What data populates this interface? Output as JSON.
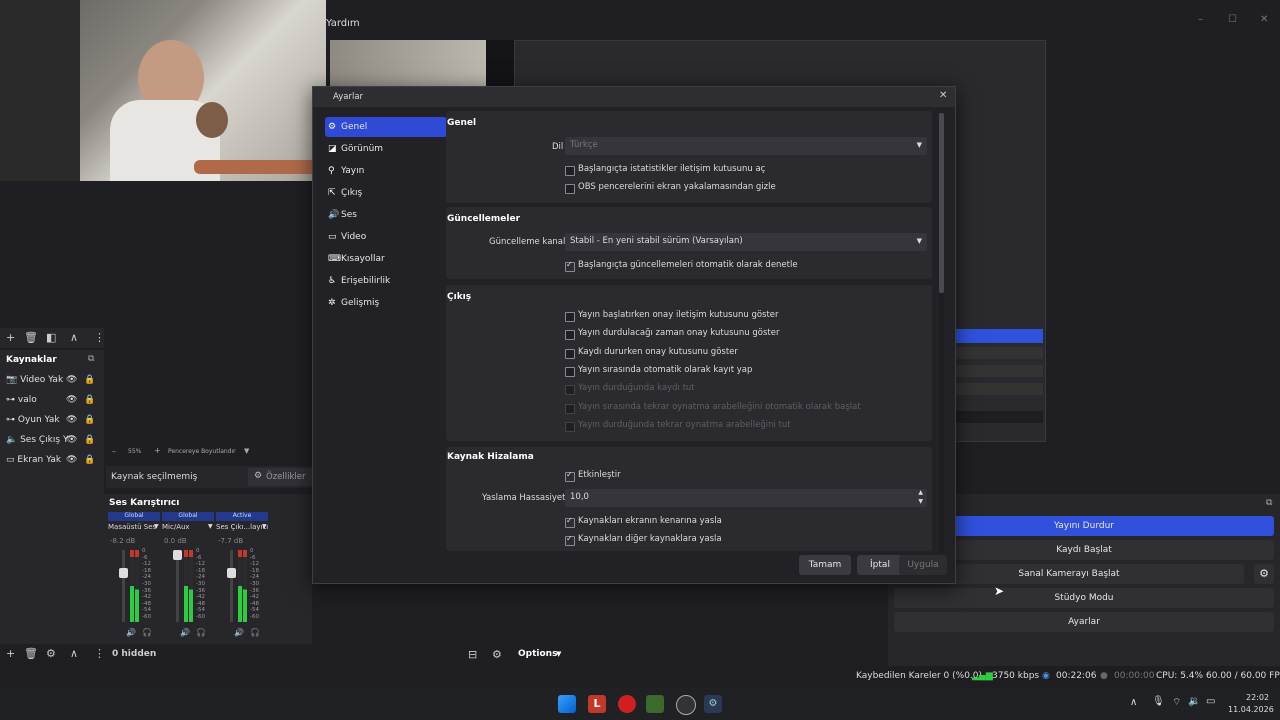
{
  "window": {
    "menu": "Yardım",
    "controls": [
      "–",
      "☐",
      "✕"
    ]
  },
  "preview_bar": {
    "zoom_minus": "–",
    "zoom": "55%",
    "zoom_plus": "+",
    "fit": "Pencereye Boyutlandır"
  },
  "sources": {
    "title": "Kaynaklar",
    "items": [
      {
        "label": "Video Yak"
      },
      {
        "label": "valo"
      },
      {
        "label": "Oyun Yak"
      },
      {
        "label": "Ses Çıkış Y"
      },
      {
        "label": "Ekran Yak"
      }
    ]
  },
  "props_bar": {
    "no_source": "Kaynak seçilmemiş",
    "properties": "Özellikler"
  },
  "mixer": {
    "title": "Ses Karıştırıcı",
    "channels": [
      {
        "scope": "Global",
        "name": "Masaüstü Ses",
        "db": "-8.2 dB"
      },
      {
        "scope": "Global",
        "name": "Mic/Aux",
        "db": "0.0 dB"
      },
      {
        "scope": "Active",
        "name": "Ses Çıkı...layıcısı",
        "db": "-7.7 dB"
      }
    ],
    "scale": [
      "0",
      "-6",
      "-12",
      "-18",
      "-24",
      "-30",
      "-36",
      "-42",
      "-48",
      "-54",
      "-60"
    ],
    "hidden": "0 hidden",
    "options": "Options"
  },
  "dialog": {
    "title": "Ayarlar",
    "close": "✕",
    "nav": [
      {
        "label": "Genel",
        "icon": "gear-icon",
        "glyph": "⚙",
        "active": true
      },
      {
        "label": "Görünüm",
        "icon": "appearance-icon",
        "glyph": "◪",
        "active": false
      },
      {
        "label": "Yayın",
        "icon": "antenna-icon",
        "glyph": "⚲",
        "active": false
      },
      {
        "label": "Çıkış",
        "icon": "output-icon",
        "glyph": "⇱",
        "active": false
      },
      {
        "label": "Ses",
        "icon": "speaker-icon",
        "glyph": "🔊",
        "active": false
      },
      {
        "label": "Video",
        "icon": "monitor-icon",
        "glyph": "▭",
        "active": false
      },
      {
        "label": "Kısayollar",
        "icon": "keyboard-icon",
        "glyph": "⌨",
        "active": false
      },
      {
        "label": "Erişebilirlik",
        "icon": "accessibility-icon",
        "glyph": "♿",
        "active": false
      },
      {
        "label": "Gelişmiş",
        "icon": "wrench-icon",
        "glyph": "✲",
        "active": false
      }
    ],
    "general": {
      "title": "Genel",
      "language_label": "Dil",
      "language_value": "Türkçe",
      "opts": [
        {
          "label": "Başlangıçta istatistikler iletişim kutusunu aç",
          "checked": false
        },
        {
          "label": "OBS pencerelerini ekran yakalamasından gizle",
          "checked": false
        }
      ]
    },
    "updates": {
      "title": "Güncellemeler",
      "channel_label": "Güncelleme kanalı",
      "channel_value": "Stabil - En yeni stabil sürüm (Varsayılan)",
      "auto_check": "Başlangıçta güncellemeleri otomatik olarak denetle"
    },
    "output": {
      "title": "Çıkış",
      "opts": [
        {
          "label": "Yayın başlatırken onay iletişim kutusunu göster",
          "checked": false,
          "disabled": false
        },
        {
          "label": "Yayın durdulacağı zaman onay kutusunu göster",
          "checked": false,
          "disabled": false
        },
        {
          "label": "Kaydı dururken onay kutusunu göster",
          "checked": false,
          "disabled": false
        },
        {
          "label": "Yayın sırasında otomatik olarak kayıt yap",
          "checked": false,
          "disabled": false
        },
        {
          "label": "Yayın durduğunda kaydı tut",
          "checked": false,
          "disabled": true
        },
        {
          "label": "Yayın sırasında tekrar oynatma arabelleğini otomatik olarak başlat",
          "checked": false,
          "disabled": true
        },
        {
          "label": "Yayın durduğunda tekrar oynatma arabelleğini tut",
          "checked": false,
          "disabled": true
        }
      ]
    },
    "snapping": {
      "title": "Kaynak Hizalama",
      "enable": "Etkinleştir",
      "sensitivity_label": "Yaslama Hassasiyeti",
      "sensitivity_value": "10,0",
      "edge": "Kaynakları ekranın kenarına yasla",
      "other": "Kaynakları diğer kaynaklara yasla"
    },
    "buttons": {
      "ok": "Tamam",
      "cancel": "İptal",
      "apply": "Uygula"
    }
  },
  "controls": {
    "stop_stream": "Yayını Durdur",
    "start_record": "Kaydı Başlat",
    "virtual_cam": "Sanal Kamerayı Başlat",
    "studio": "Stüdyo Modu",
    "settings": "Ayarlar"
  },
  "status": {
    "dropped": "Kaybedilen Kareler 0 (%0.0)",
    "bitrate": "3750 kbps",
    "stream_time": "00:22:06",
    "record_time": "00:00:00",
    "cpu": "CPU: 5.4%",
    "fps": "60.00 / 60.00 FPS"
  },
  "taskbar": {
    "time": "22:02",
    "date": "11.04.2026"
  },
  "colors": {
    "accent": "#3151dc",
    "nav_active": "#2f4bd6",
    "meter_green": "#2ecc40",
    "meter_red": "#c0392b"
  }
}
